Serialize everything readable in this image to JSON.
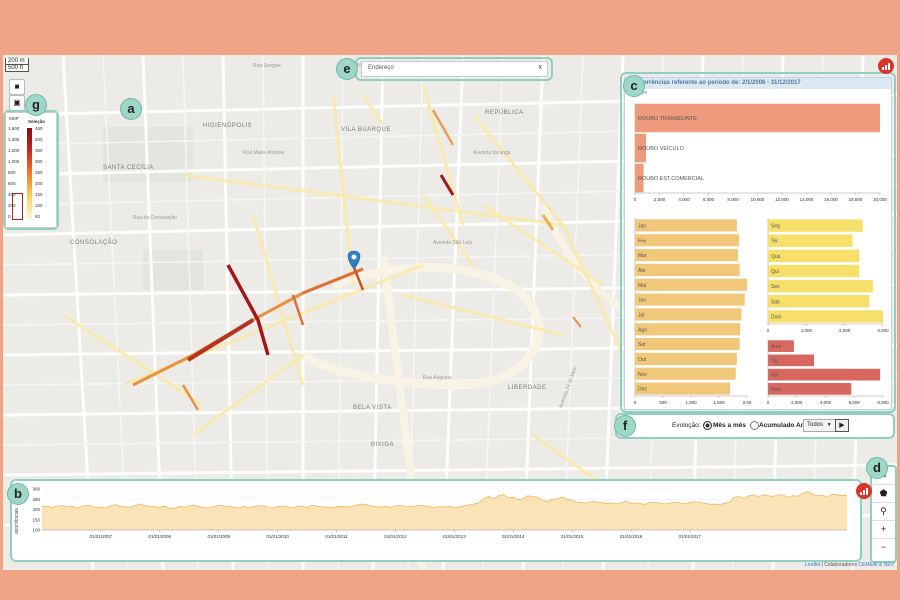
{
  "map": {
    "scale_m": "200 m",
    "scale_ft": "500 ft",
    "districts": [
      "HIGIENÓPOLIS",
      "VILA BUARQUE",
      "REPÚBLICA",
      "CONSOLAÇÃO",
      "SANTA CECÍLIA",
      "LIBERDADE",
      "BELA VISTA",
      "BIXIGA"
    ],
    "streets": [
      "Rua Sergipe",
      "Rua Maria Antônia",
      "Avenida São Luís",
      "Rua Amaral Gurgel",
      "Avenida Ipiranga",
      "Rua Augusta",
      "Avenida 23 de Maio",
      "Rua da Consolação"
    ],
    "address_placeholder": "Endereço",
    "address_clear": "x",
    "attribution_leaflet": "Leaflet",
    "attribution_sep": " | Colaboradores",
    "attribution_link": "CEMEAI & NEV"
  },
  "callouts": {
    "a": "a",
    "b": "b",
    "c": "c",
    "d": "d",
    "e": "e",
    "f": "f",
    "g": "g"
  },
  "legend": {
    "title_left": "MSP",
    "title_right": "Seleção",
    "left_ticks": [
      "1,600",
      "1,400",
      "1,200",
      "1,000",
      "800",
      "600",
      "400",
      "200",
      "0"
    ],
    "right_ticks": [
      "450",
      "400",
      "350",
      "300",
      "250",
      "200",
      "150",
      "100",
      "50"
    ]
  },
  "panel": {
    "header": "Ocorrências referente ao período de: 2/1/2006 - 31/12/2017",
    "filter_label": "Filtro"
  },
  "evolution": {
    "label": "Evolução:",
    "option_monthly": "Mês a mês",
    "option_annual": "Acumulado Anual",
    "select_value": "Todos",
    "play_icon": "play-icon"
  },
  "timeline": {
    "y_label": "ocorrências"
  },
  "zoom": {
    "in": "+",
    "out": "−"
  },
  "colors": {
    "crime_bar": "#ee9a7d",
    "month_bar": "#f1c87a",
    "weekday_bar": "#f6e06a",
    "period_bar": "#d8685f",
    "timeline_fill": "#fbe3b8",
    "timeline_line": "#f0b75a",
    "accent_teal": "#8fd0c0",
    "signal_red": "#d9342b"
  },
  "chart_data": [
    {
      "type": "bar",
      "orientation": "horizontal",
      "categories": [
        "ROUBO TRANSEUNTE",
        "ROUBO VEÍCULO",
        "ROUBO EST.COMERCIAL"
      ],
      "values": [
        20000,
        900,
        700
      ],
      "xlim": [
        0,
        20000
      ],
      "ticks": [
        "0",
        "2,000",
        "4,000",
        "6,000",
        "8,000",
        "10,000",
        "12,000",
        "14,000",
        "16,000",
        "18,000",
        "20,000"
      ]
    },
    {
      "type": "bar",
      "orientation": "horizontal",
      "categories": [
        "Jan",
        "Fev",
        "Mar",
        "Abr",
        "Mai",
        "Jun",
        "Jul",
        "Ago",
        "Set",
        "Out",
        "Nov",
        "Dez"
      ],
      "values": [
        1820,
        1860,
        1840,
        1870,
        2000,
        1960,
        1900,
        1880,
        1870,
        1820,
        1800,
        1700
      ],
      "xlim": [
        0,
        2000
      ],
      "ticks": [
        "0",
        "500",
        "1,000",
        "1,500",
        "2,00"
      ]
    },
    {
      "type": "bar",
      "orientation": "horizontal",
      "categories": [
        "Seg",
        "Ter",
        "Qua",
        "Qui",
        "Sex",
        "Sab",
        "Dom"
      ],
      "values": [
        2800,
        2500,
        2700,
        2700,
        3100,
        3000,
        3400
      ],
      "xlim": [
        0,
        3400
      ],
      "ticks": [
        "0",
        "1,000",
        "2,000",
        "3,000"
      ]
    },
    {
      "type": "bar",
      "orientation": "horizontal",
      "categories": [
        "Ama",
        "Tar",
        "Noi",
        "Mad"
      ],
      "values": [
        1800,
        3200,
        7800,
        5800
      ],
      "xlim": [
        0,
        8000
      ],
      "ticks": [
        "0",
        "2,000",
        "4,000",
        "6,000",
        "8,000"
      ]
    },
    {
      "type": "area",
      "x_ticks": [
        "01/01/2007",
        "01/01/2008",
        "01/01/2009",
        "01/01/2010",
        "01/01/2011",
        "01/01/2012",
        "01/01/2013",
        "01/01/2014",
        "01/01/2015",
        "01/01/2016",
        "01/01/2017"
      ],
      "y_ticks": [
        "300",
        "250",
        "200",
        "150",
        "100"
      ],
      "ylim": [
        0,
        300
      ],
      "x_start": "2006-01",
      "values": [
        170,
        175,
        165,
        172,
        180,
        168,
        175,
        160,
        170,
        182,
        176,
        165,
        168,
        160,
        178,
        185,
        172,
        170,
        165,
        180,
        190,
        178,
        175,
        170,
        168,
        174,
        160,
        158,
        172,
        168,
        176,
        182,
        170,
        165,
        160,
        172,
        180,
        176,
        170,
        168,
        160,
        172,
        165,
        170,
        176,
        180,
        165,
        160,
        170,
        175,
        168,
        160,
        176,
        172,
        165,
        180,
        175,
        170,
        168,
        162,
        170,
        174,
        168,
        172,
        180,
        190,
        185,
        176,
        170,
        168,
        172,
        165,
        176,
        180,
        172,
        168,
        175,
        182,
        176,
        170,
        165,
        172,
        168,
        175,
        160,
        168,
        178,
        184,
        190,
        200,
        230,
        245,
        228,
        250,
        260,
        235,
        240,
        220,
        230,
        250,
        245,
        238,
        215,
        210,
        225,
        230,
        240,
        226,
        218,
        205,
        200,
        196,
        210,
        205,
        200,
        195,
        198,
        190,
        200,
        210,
        195,
        198,
        192,
        188,
        205,
        200,
        198,
        190,
        196,
        205,
        198,
        190,
        200,
        208,
        202,
        195,
        188,
        190,
        185,
        196,
        200,
        240,
        245,
        230,
        250,
        255,
        240,
        260,
        250,
        245,
        260,
        255,
        240,
        250,
        248,
        270,
        280,
        260,
        250,
        255,
        240,
        262,
        258,
        250,
        256
      ]
    }
  ]
}
